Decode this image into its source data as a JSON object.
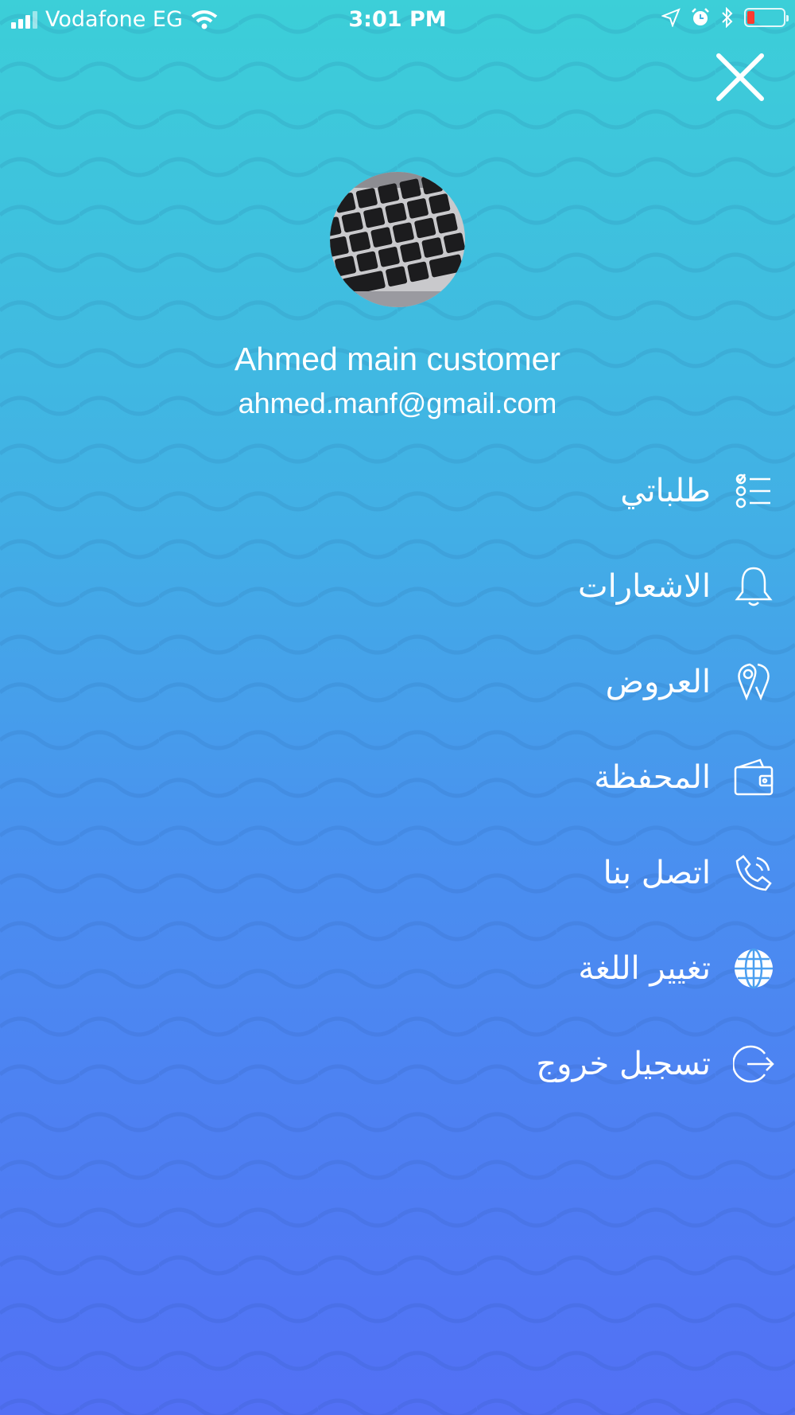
{
  "status_bar": {
    "carrier": "Vodafone EG",
    "time": "3:01 PM"
  },
  "colors": {
    "gradient_top": "#3ccfd8",
    "gradient_bottom": "#5270f5",
    "battery_low": "#ff3b30"
  },
  "header": {
    "close_icon": "close-icon"
  },
  "profile": {
    "name": "Ahmed main customer",
    "email": "ahmed.manf@gmail.com",
    "avatar_icon": "keyboard-photo"
  },
  "menu": {
    "items": [
      {
        "label": "طلباتي",
        "icon": "checklist-icon"
      },
      {
        "label": "الاشعارات",
        "icon": "bell-icon"
      },
      {
        "label": "العروض",
        "icon": "offers-tag-icon"
      },
      {
        "label": "المحفظة",
        "icon": "wallet-icon"
      },
      {
        "label": "اتصل بنا",
        "icon": "phone-icon"
      },
      {
        "label": "تغيير اللغة",
        "icon": "globe-icon"
      },
      {
        "label": "تسجيل خروج",
        "icon": "logout-icon"
      }
    ]
  }
}
